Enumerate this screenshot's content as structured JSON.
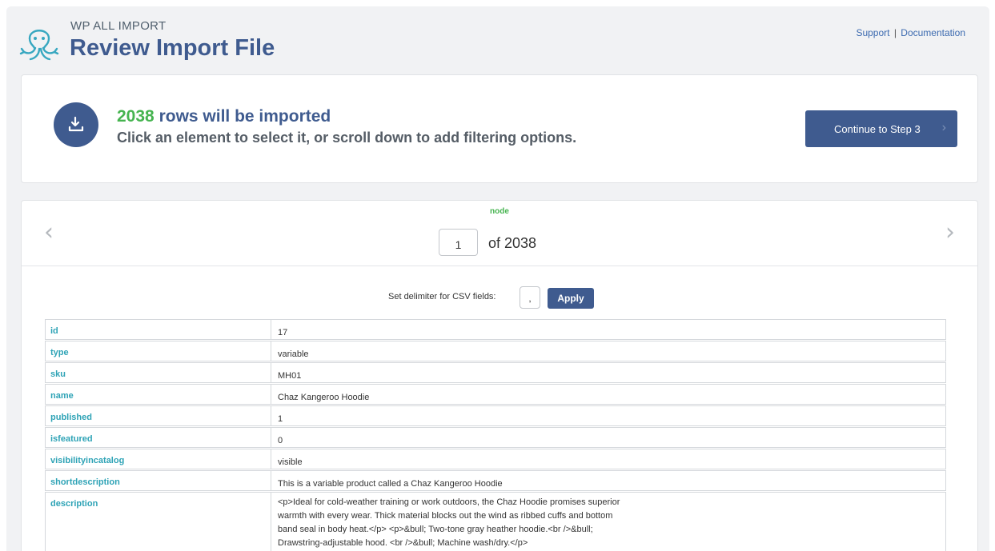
{
  "header": {
    "brand": "WP ALL IMPORT",
    "title": "Review Import File",
    "support_link": "Support",
    "separator": "|",
    "documentation_link": "Documentation"
  },
  "summary": {
    "row_count": "2038",
    "rows_text": "rows will be imported",
    "hint": "Click an element to select it, or scroll down to add filtering options.",
    "continue_label": "Continue to Step 3",
    "continue_chevron": "›"
  },
  "navigator": {
    "node_label": "node",
    "current_page": "1",
    "of_total": "of 2038",
    "prev_arrow": "‹",
    "next_arrow": "›"
  },
  "delimiter": {
    "label": "Set delimiter for CSV fields:",
    "value": ",",
    "apply_label": "Apply"
  },
  "fields": [
    {
      "key": "id",
      "value": "17"
    },
    {
      "key": "type",
      "value": "variable"
    },
    {
      "key": "sku",
      "value": "MH01"
    },
    {
      "key": "name",
      "value": "Chaz Kangeroo Hoodie"
    },
    {
      "key": "published",
      "value": "1"
    },
    {
      "key": "isfeatured",
      "value": "0"
    },
    {
      "key": "visibilityincatalog",
      "value": "visible"
    },
    {
      "key": "shortdescription",
      "value": "This is a variable product called a Chaz Kangeroo Hoodie"
    },
    {
      "key": "description",
      "value_lines": [
        "<p>Ideal for cold-weather training or work outdoors, the Chaz Hoodie promises superior",
        "warmth with every wear. Thick material blocks out the wind as ribbed cuffs and bottom",
        "band seal in body heat.</p> <p>&bull; Two-tone gray heather hoodie.<br />&bull;",
        "Drawstring-adjustable hood. <br />&bull; Machine wash/dry.</p>"
      ]
    }
  ],
  "colors": {
    "brand_blue": "#3f5b8f",
    "count_green": "#46b450",
    "field_key_teal": "#2ea3b6"
  },
  "icons": {
    "logo": "octopus-logo-icon",
    "import": "download-tray-icon"
  }
}
